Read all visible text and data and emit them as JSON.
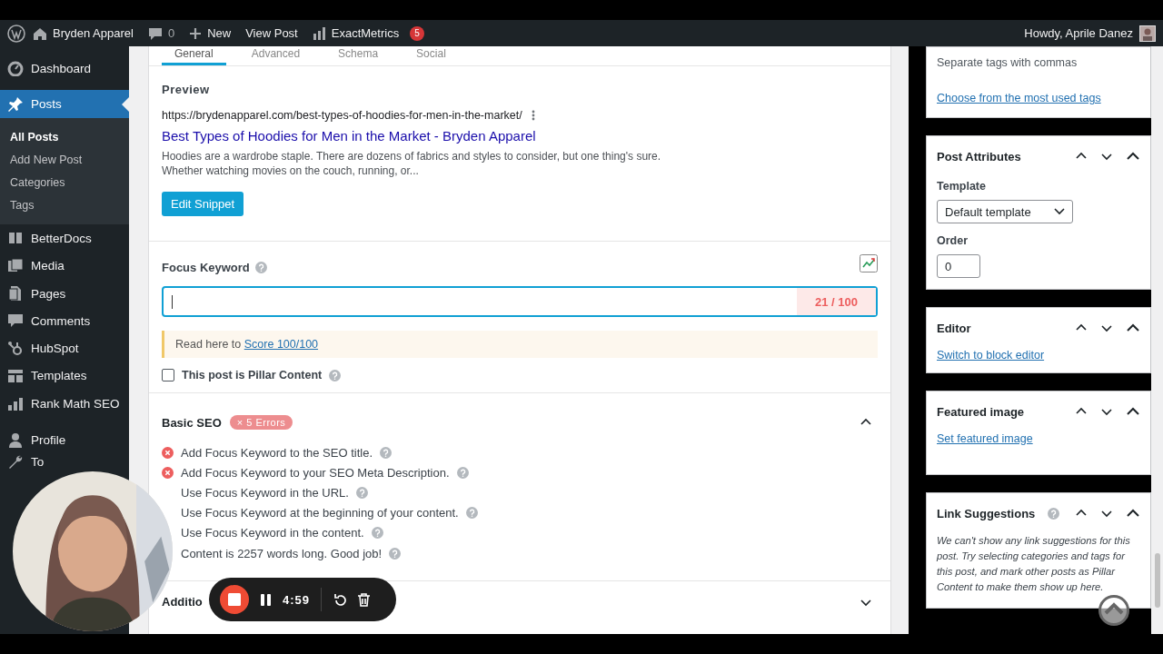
{
  "admin_bar": {
    "site_name": "Bryden Apparel",
    "comments_count": "0",
    "new_label": "New",
    "view_post": "View Post",
    "analytics": "ExactMetrics",
    "analytics_badge": "5",
    "greeting": "Howdy, Aprile Danez"
  },
  "sidebar": {
    "items": [
      {
        "label": "Dashboard",
        "selected": false
      },
      {
        "label": "Posts",
        "selected": true,
        "children": [
          {
            "label": "All Posts",
            "selected": true
          },
          {
            "label": "Add New Post",
            "selected": false
          },
          {
            "label": "Categories",
            "selected": false
          },
          {
            "label": "Tags",
            "selected": false
          }
        ]
      },
      {
        "label": "BetterDocs",
        "selected": false
      },
      {
        "label": "Media",
        "selected": false
      },
      {
        "label": "Pages",
        "selected": false
      },
      {
        "label": "Comments",
        "selected": false
      },
      {
        "label": "HubSpot",
        "selected": false
      },
      {
        "label": "Templates",
        "selected": false
      },
      {
        "label": "Rank Math SEO",
        "selected": false
      },
      {
        "label": "Profile",
        "selected": false
      },
      {
        "label": "To",
        "selected": false
      }
    ]
  },
  "editor": {
    "tabs": [
      {
        "label": "General",
        "selected": true
      },
      {
        "label": "Advanced",
        "selected": false
      },
      {
        "label": "Schema",
        "selected": false
      },
      {
        "label": "Social",
        "selected": false
      }
    ],
    "preview": {
      "heading": "Preview",
      "url": "https://brydenapparel.com/best-types-of-hoodies-for-men-in-the-market/",
      "title": "Best Types of Hoodies for Men in the Market - Bryden Apparel",
      "description_lines": [
        "Hoodies are a wardrobe staple. There are dozens of fabrics and styles to consider, but one thing's sure.",
        "Whether watching movies on the couch, running, or..."
      ]
    },
    "edit_snippet": "Edit Snippet",
    "focus_keyword": {
      "label": "Focus Keyword",
      "score": "21 / 100"
    },
    "notice": {
      "text": "Read here to",
      "link": "Score 100/100"
    },
    "pillar": {
      "label": "This post is Pillar Content",
      "checked": false
    },
    "basic_seo": {
      "title": "Basic SEO",
      "badge": "× 5 Errors",
      "expanded": true,
      "checks": [
        {
          "text": "Add Focus Keyword to the SEO title.",
          "kind": "error"
        },
        {
          "text": "Add Focus Keyword to your SEO Meta Description.",
          "kind": "error"
        },
        {
          "text": "Use Focus Keyword in the URL."
        },
        {
          "text": "Use Focus Keyword at the beginning of your content."
        },
        {
          "text": "Use Focus Keyword in the content."
        },
        {
          "text": "Content is 2257 words long. Good job!"
        }
      ]
    },
    "additional": {
      "title": "Additio",
      "expanded": false
    }
  },
  "side_boxes": {
    "tags": {
      "hint": "Separate tags with commas",
      "link": "Choose from the most used tags"
    },
    "post_attributes": {
      "title": "Post Attributes",
      "template_label": "Template",
      "template_value": "Default template",
      "order_label": "Order",
      "order_value": "0"
    },
    "editor": {
      "title": "Editor",
      "link": "Switch to block editor"
    },
    "featured_image": {
      "title": "Featured image",
      "link": "Set featured image"
    },
    "link_suggestions": {
      "title": "Link Suggestions",
      "text": "We can't show any link suggestions for this post. Try selecting categories and tags for this post, and mark other posts as Pillar Content to make them show up here."
    }
  },
  "recorder": {
    "time": "4:59"
  }
}
